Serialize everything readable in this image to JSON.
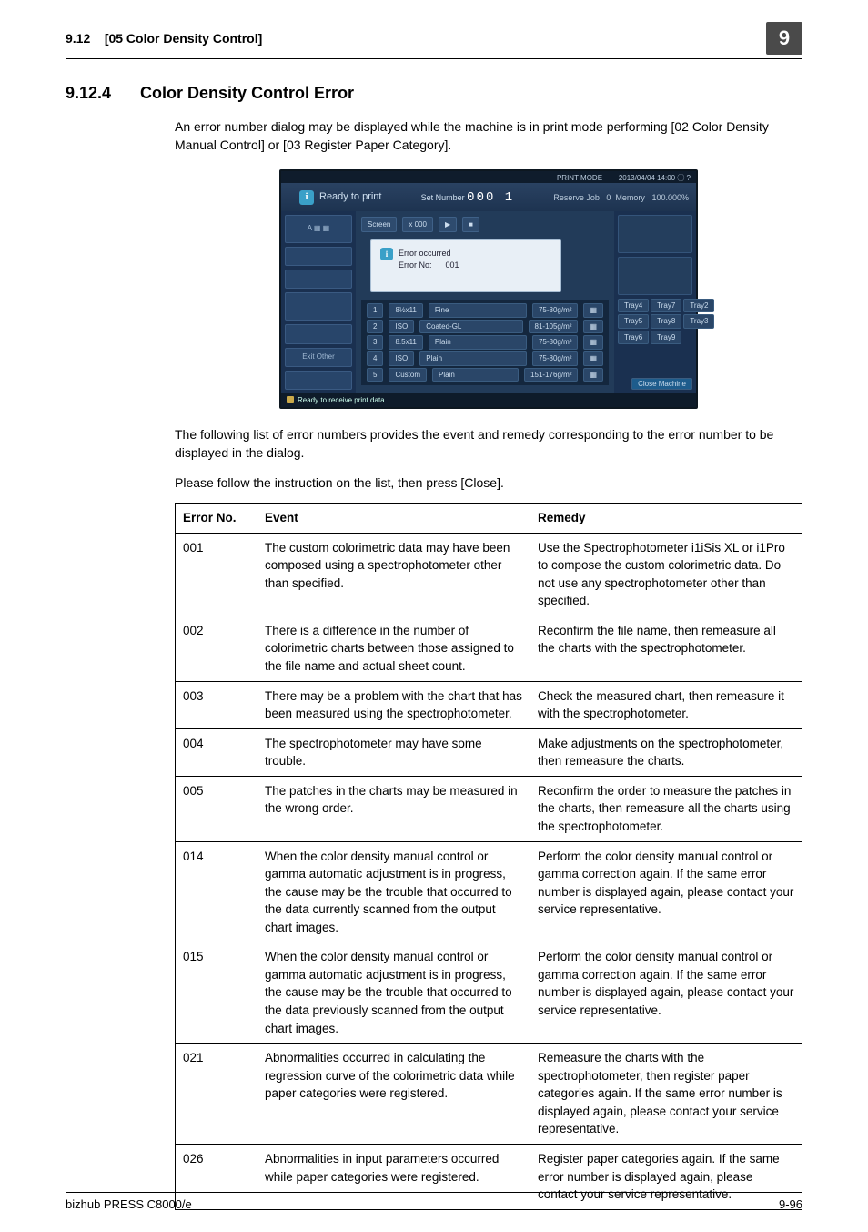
{
  "header": {
    "section_num": "9.12",
    "section_title": "[05 Color Density Control]",
    "chapter": "9"
  },
  "heading": {
    "num": "9.12.4",
    "title": "Color Density Control Error"
  },
  "intro_para": "An error number dialog may be displayed while the machine is in print mode performing [02 Color Density Manual Control] or [03 Register Paper Category].",
  "after_img_para1": "The following list of error numbers provides the event and remedy corresponding to the error number to be displayed in the dialog.",
  "after_img_para2": "Please follow the instruction on the list, then press [Close].",
  "screenshot": {
    "date": "2013/04/04 14:00",
    "mode_label": "PRINT MODE",
    "ready": "Ready to print",
    "set_number_label": "Set Number",
    "set_number_value": "000 1",
    "reserve": "Reserve Job",
    "memory_label": "Memory",
    "memory_value": "100.000%",
    "zero": "0",
    "screen_btn": "Screen",
    "x000": "x 000",
    "dialog_line1": "Error occurred",
    "dialog_line2": "Error No:",
    "dialog_code": "001",
    "left_tiles": [
      "",
      "A",
      "",
      "",
      "",
      "",
      "Exit Other"
    ],
    "right_btns": [
      "Tray4",
      "Tray7",
      "Tray2",
      "Tray5",
      "Tray8",
      "Tray3",
      "Tray6",
      "Tray9"
    ],
    "bottom_rows": [
      [
        "1",
        "8½x11",
        "Fine",
        "75-80g/m²"
      ],
      [
        "2",
        "ISO",
        "Coated-GL",
        "81-105g/m²"
      ],
      [
        "3",
        "8.5x11",
        "Plain",
        "75-80g/m²"
      ],
      [
        "4",
        "ISO",
        "Plain",
        "75-80g/m²"
      ],
      [
        "5",
        "Custom",
        "Plain",
        "151-176g/m²"
      ]
    ],
    "close_machine": "Close Machine",
    "footer": "Ready to receive print data"
  },
  "table": {
    "headers": {
      "no": "Error No.",
      "event": "Event",
      "remedy": "Remedy"
    },
    "rows": [
      {
        "no": "001",
        "event": "The custom colorimetric data may have been composed using a spectrophotometer other than specified.",
        "remedy": "Use the Spectrophotometer i1iSis XL or i1Pro to compose the custom colorimetric data. Do not use any spectrophotometer other than specified."
      },
      {
        "no": "002",
        "event": "There is a difference in the number of colorimetric charts between those assigned to the file name and actual sheet count.",
        "remedy": "Reconfirm the file name, then remeasure all the charts with the spectrophotometer."
      },
      {
        "no": "003",
        "event": "There may be a problem with the chart that has been measured using the spectrophotometer.",
        "remedy": "Check the measured chart, then remeasure it with the spectrophotometer."
      },
      {
        "no": "004",
        "event": "The spectrophotometer may have some trouble.",
        "remedy": "Make adjustments on the spectrophotometer, then remeasure the charts."
      },
      {
        "no": "005",
        "event": "The patches in the charts may be measured in the wrong order.",
        "remedy": "Reconfirm the order to measure the patches in the charts, then remeasure all the charts using the spectrophotometer."
      },
      {
        "no": "014",
        "event": "When the color density manual control or gamma automatic adjustment is in progress, the cause may be the trouble that occurred to the data currently scanned from the output chart images.",
        "remedy": "Perform the color density manual control or gamma correction again. If the same error number is displayed again, please contact your service representative."
      },
      {
        "no": "015",
        "event": "When the color density manual control or gamma automatic adjustment is in progress, the cause may be the trouble that occurred to the data previously scanned from the output chart images.",
        "remedy": "Perform the color density manual control or gamma correction again. If the same error number is displayed again, please contact your service representative."
      },
      {
        "no": "021",
        "event": "Abnormalities occurred in calculating the regression curve of the colorimetric data while paper categories were registered.",
        "remedy": "Remeasure the charts with the spectrophotometer, then register paper categories again. If the same error number is displayed again, please contact your service representative."
      },
      {
        "no": "026",
        "event": "Abnormalities in input parameters occurred while paper categories were registered.",
        "remedy": "Register paper categories again. If the same error number is displayed again, please contact your service representative."
      }
    ]
  },
  "footer": {
    "model": "bizhub PRESS C8000/e",
    "page": "9-96"
  }
}
